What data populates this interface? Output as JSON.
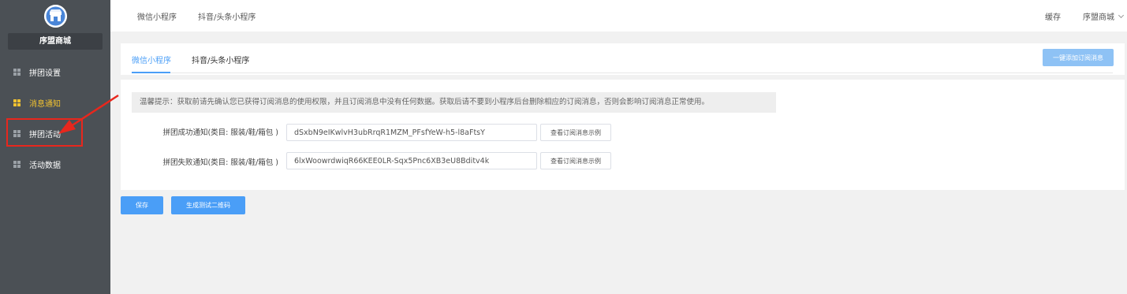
{
  "sidebar": {
    "shop_name": "序盟商城",
    "logo_icon": "store-icon",
    "items": [
      {
        "label": "拼团设置",
        "icon": "grid-icon",
        "active": false
      },
      {
        "label": "消息通知",
        "icon": "grid-icon",
        "active": true
      },
      {
        "label": "拼团活动",
        "icon": "grid-icon",
        "active": false
      },
      {
        "label": "活动数据",
        "icon": "grid-icon",
        "active": false
      }
    ],
    "active_color": "#f2c230"
  },
  "topbar": {
    "tabs": [
      "微信小程序",
      "抖音/头条小程序"
    ],
    "cache_label": "缓存",
    "user_label": "序盟商城"
  },
  "content": {
    "tabs": [
      {
        "label": "微信小程序",
        "active": true
      },
      {
        "label": "抖音/头条小程序",
        "active": false
      }
    ],
    "add_button": "一键添加订阅消息",
    "tip": "温馨提示：获取前请先确认您已获得订阅消息的使用权限，并且订阅消息中没有任何数据。获取后请不要到小程序后台删除相应的订阅消息，否则会影响订阅消息正常使用。",
    "rows": [
      {
        "label": "拼团成功通知(类目: 服装/鞋/箱包 )",
        "value": "dSxbN9eIKwlvH3ubRrqR1MZM_PFsfYeW-h5-l8aFtsY",
        "button": "查看订阅消息示例"
      },
      {
        "label": "拼团失败通知(类目: 服装/鞋/箱包 )",
        "value": "6lxWoowrdwiqR66KEE0LR-Sqx5Pnc6XB3eU8Bditv4k",
        "button": "查看订阅消息示例"
      }
    ]
  },
  "actions": {
    "save": "保存",
    "generate_qr": "生成测试二维码"
  },
  "colors": {
    "accent": "#4a9ef7",
    "sidebar_bg": "#4b5055",
    "annotation": "#e8271d"
  }
}
